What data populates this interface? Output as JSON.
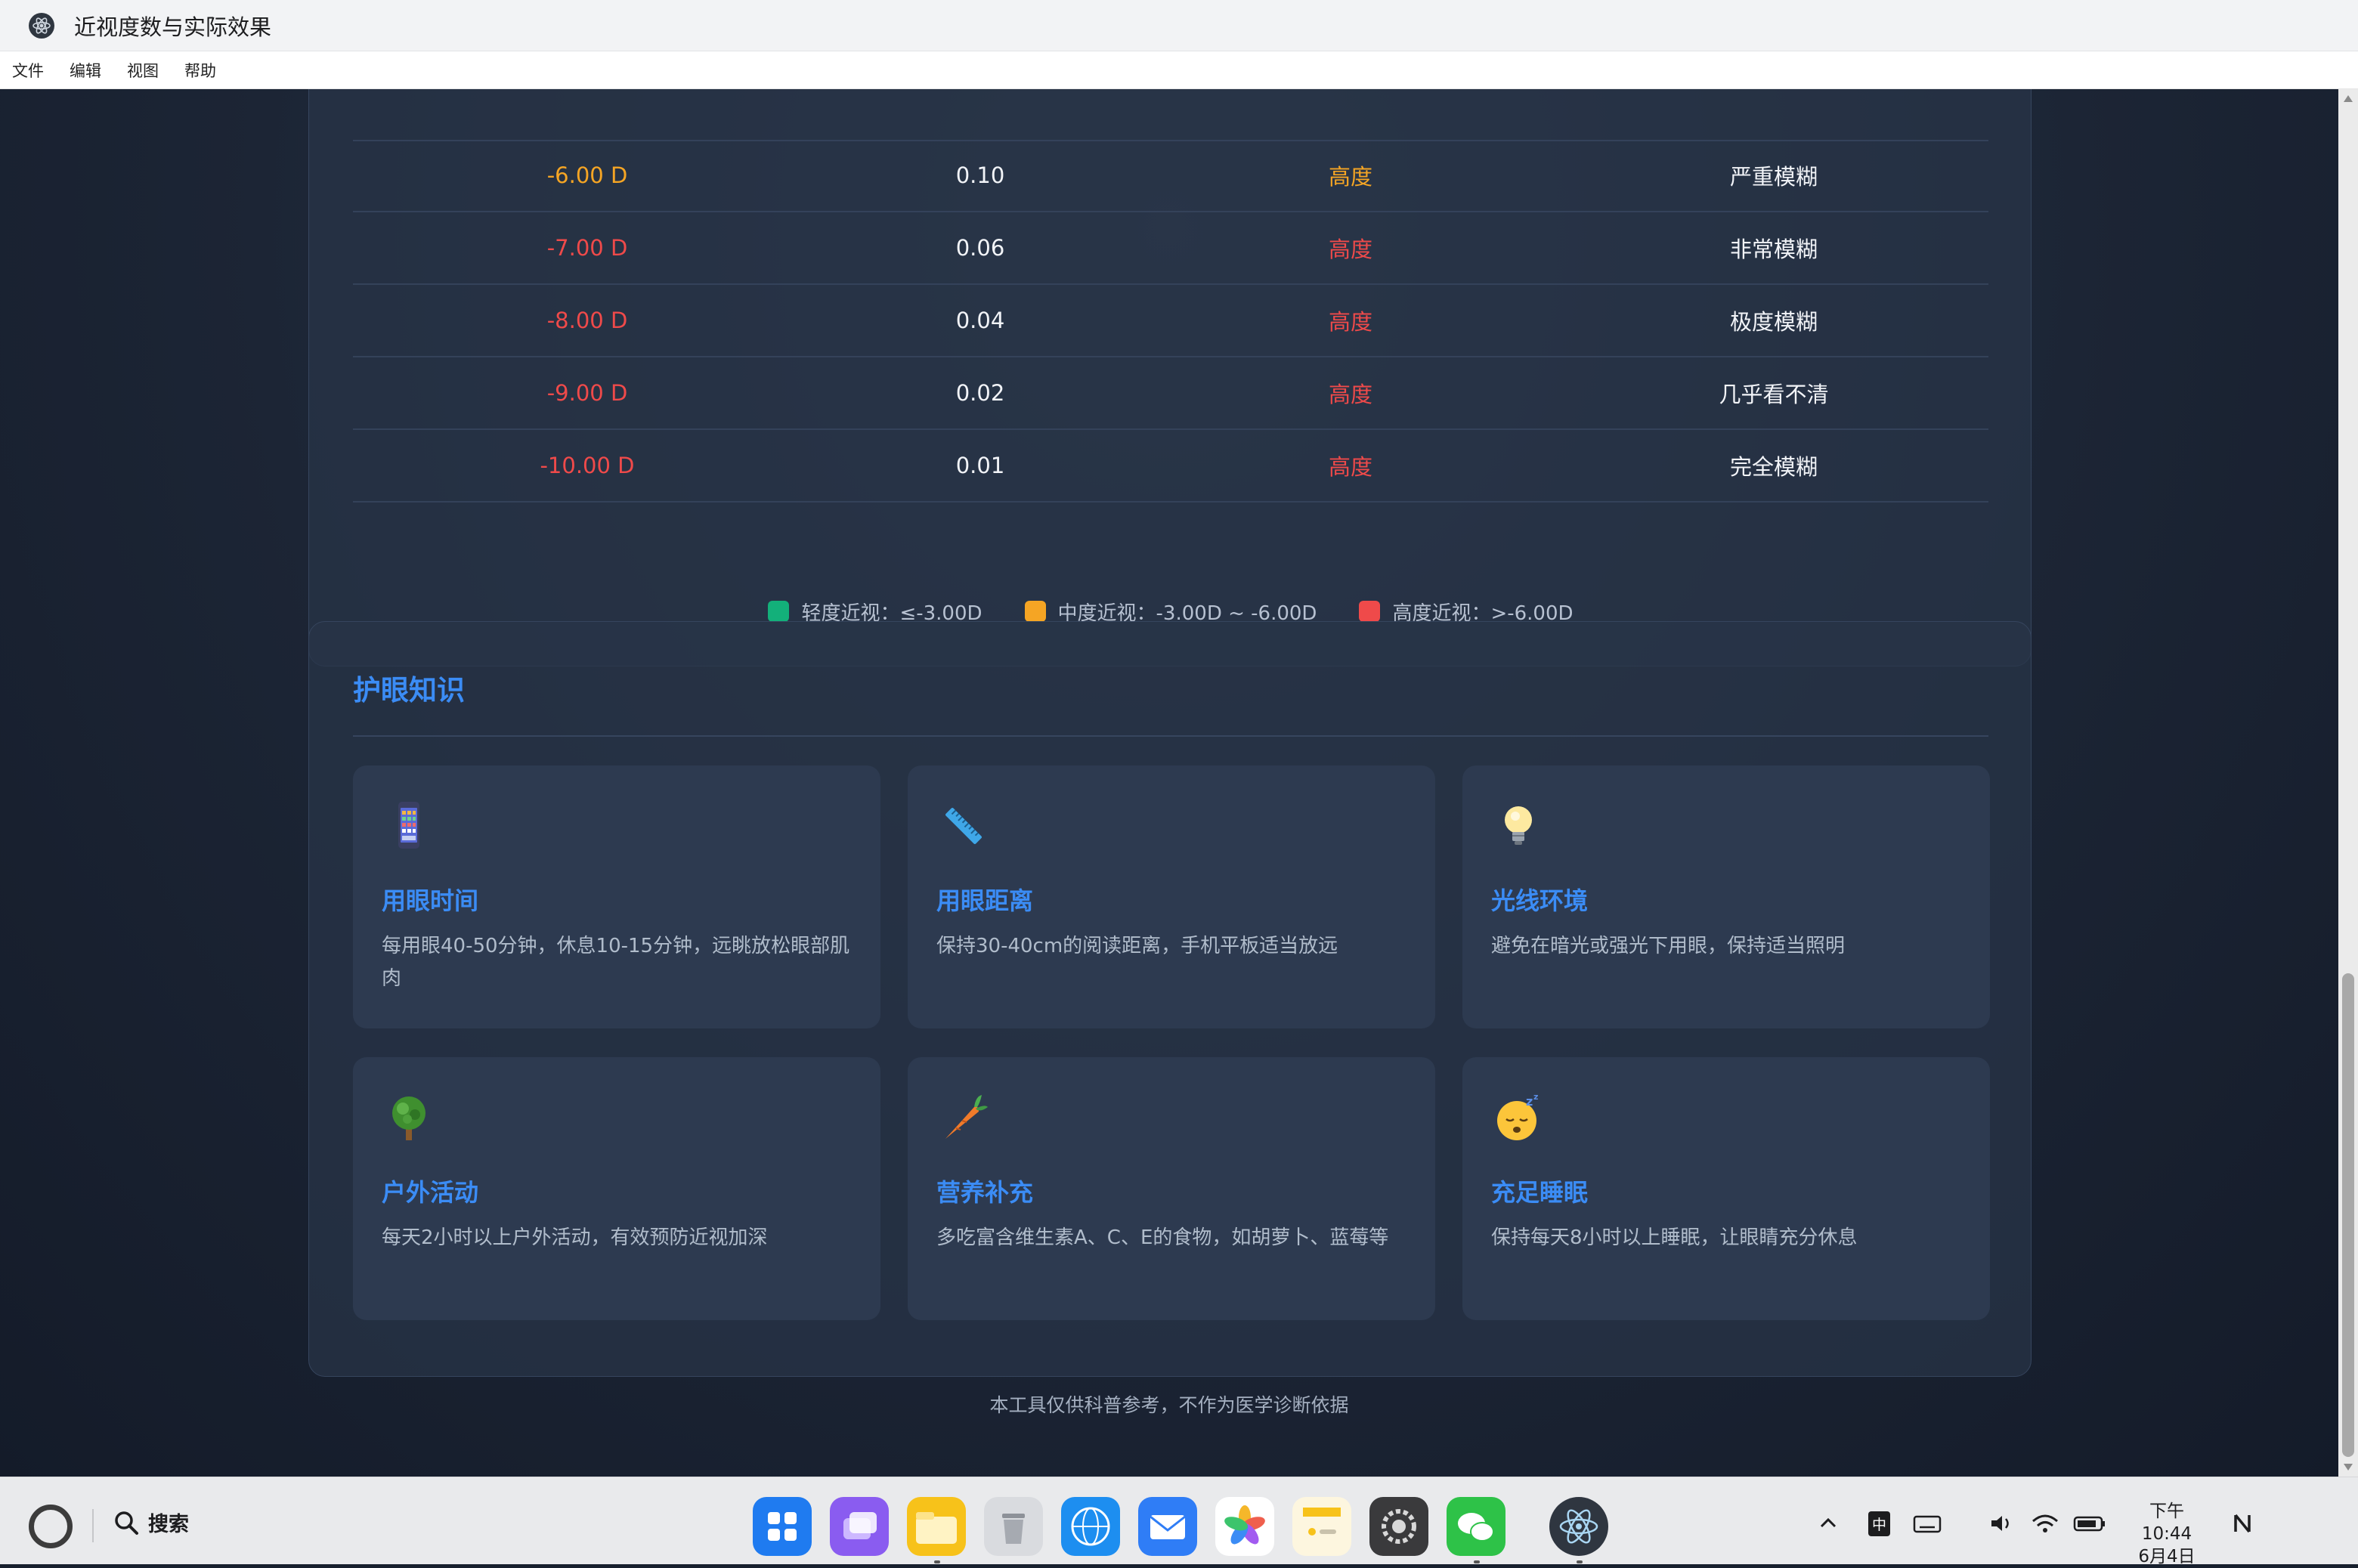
{
  "window": {
    "title": "近视度数与实际效果"
  },
  "menu": [
    "文件",
    "编辑",
    "视图",
    "帮助"
  ],
  "table": {
    "rows": [
      {
        "diopter": "-6.00 D",
        "acuity": "0.10",
        "level": "高度",
        "effect": "严重模糊",
        "diopter_color": "orange",
        "level_color": "orange"
      },
      {
        "diopter": "-7.00 D",
        "acuity": "0.06",
        "level": "高度",
        "effect": "非常模糊",
        "diopter_color": "red",
        "level_color": "red"
      },
      {
        "diopter": "-8.00 D",
        "acuity": "0.04",
        "level": "高度",
        "effect": "极度模糊",
        "diopter_color": "red",
        "level_color": "red"
      },
      {
        "diopter": "-9.00 D",
        "acuity": "0.02",
        "level": "高度",
        "effect": "几乎看不清",
        "diopter_color": "red",
        "level_color": "red"
      },
      {
        "diopter": "-10.00 D",
        "acuity": "0.01",
        "level": "高度",
        "effect": "完全模糊",
        "diopter_color": "red",
        "level_color": "red"
      }
    ],
    "legend": [
      {
        "label": "轻度近视：≤-3.00D",
        "color": "#13b07a"
      },
      {
        "label": "中度近视：-3.00D ~ -6.00D",
        "color": "#f5a524"
      },
      {
        "label": "高度近视：>-6.00D",
        "color": "#ef4a4a"
      }
    ]
  },
  "eye_care": {
    "title": "护眼知识",
    "tips": [
      {
        "icon": "phone-icon",
        "title": "用眼时间",
        "text": "每用眼40-50分钟，休息10-15分钟，远眺放松眼部肌肉"
      },
      {
        "icon": "ruler-icon",
        "title": "用眼距离",
        "text": "保持30-40cm的阅读距离，手机平板适当放远"
      },
      {
        "icon": "light-bulb-icon",
        "title": "光线环境",
        "text": "避免在暗光或强光下用眼，保持适当照明"
      },
      {
        "icon": "tree-icon",
        "title": "户外活动",
        "text": "每天2小时以上户外活动，有效预防近视加深"
      },
      {
        "icon": "carrot-icon",
        "title": "营养补充",
        "text": "多吃富含维生素A、C、E的食物，如胡萝卜、蓝莓等"
      },
      {
        "icon": "sleeping-face-icon",
        "title": "充足睡眠",
        "text": "保持每天8小时以上睡眠，让眼睛充分休息"
      }
    ]
  },
  "footer": {
    "note": "本工具仅供科普参考，不作为医学诊断依据"
  },
  "taskbar": {
    "search_label": "搜索",
    "ime": "中",
    "clock_time": "下午10:44",
    "clock_date": "6月4日",
    "apps": [
      "app-grid-icon",
      "multitask-icon",
      "files-icon",
      "trash-icon",
      "browser-icon",
      "mail-icon",
      "photos-icon",
      "notes-icon",
      "settings-icon",
      "wechat-icon",
      "electron-icon"
    ]
  }
}
